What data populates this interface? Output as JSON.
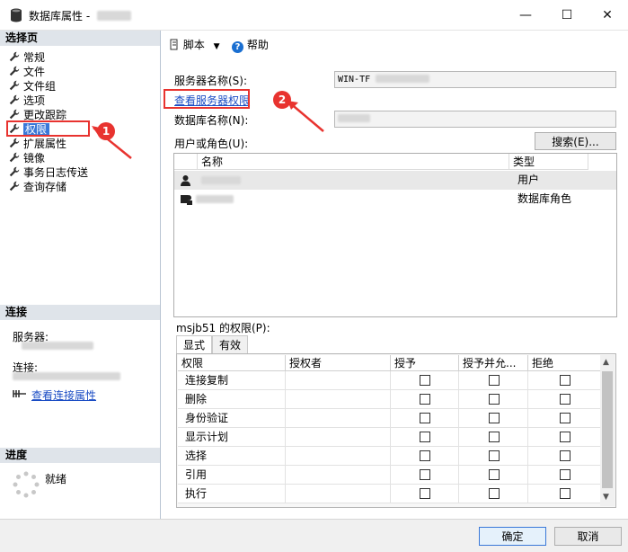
{
  "window": {
    "title": "数据库属性 -",
    "min": "—",
    "max": "☐",
    "close": "✕"
  },
  "left": {
    "select_page_header": "选择页",
    "nav_items": [
      "常规",
      "文件",
      "文件组",
      "选项",
      "更改跟踪",
      "权限",
      "扩展属性",
      "镜像",
      "事务日志传送",
      "查询存储"
    ],
    "selected_index": 5,
    "connection_header": "连接",
    "server_label": "服务器:",
    "connection_label": "连接:",
    "view_connection_props": "查看连接属性",
    "progress_header": "进度",
    "progress_status": "就绪"
  },
  "toolbar": {
    "script": "脚本",
    "help": "帮助"
  },
  "main": {
    "server_name_label": "服务器名称(S):",
    "server_name_value": "WIN-TF",
    "view_server_permissions": "查看服务器权限",
    "db_name_label": "数据库名称(N):",
    "users_roles_label": "用户或角色(U):",
    "search_button": "搜索(E)...",
    "list_columns": [
      "名称",
      "类型"
    ],
    "list_rows": [
      {
        "type": "用户",
        "icon": "user-icon"
      },
      {
        "type": "数据库角色",
        "icon": "role-icon"
      }
    ],
    "permissions_for_label": "msjb51 的权限(P):",
    "tabs": [
      "显式",
      "有效"
    ],
    "perm_columns": [
      "权限",
      "授权者",
      "授予",
      "授予并允...",
      "拒绝"
    ],
    "perm_rows": [
      "连接复制",
      "删除",
      "身份验证",
      "显示计划",
      "选择",
      "引用",
      "执行"
    ]
  },
  "footer": {
    "ok": "确定",
    "cancel": "取消"
  },
  "annotations": [
    "1",
    "2"
  ],
  "colors": {
    "accent": "#3a78d8",
    "annotation": "#e8332f",
    "link": "#1a4cc4"
  }
}
